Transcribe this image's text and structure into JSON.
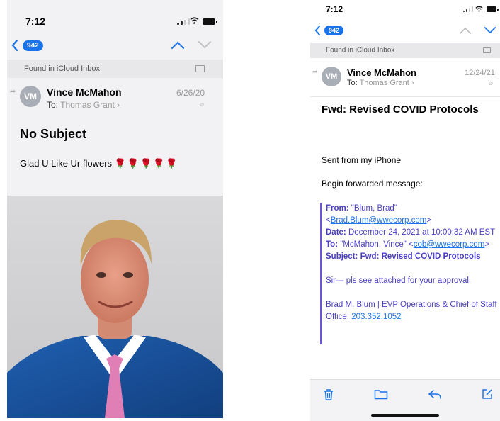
{
  "left": {
    "time": "7:12",
    "badge": "942",
    "found_label": "Found in iCloud Inbox",
    "avatar": "VM",
    "sender": "Vince McMahon",
    "to_prefix": "To:",
    "to_name": "Thomas Grant",
    "date": "6/26/20",
    "subject": "No Subject",
    "body": "Glad U Like Ur flowers",
    "roses": [
      "🌹",
      "🌹",
      "🌹",
      "🌹",
      "🌹"
    ]
  },
  "right": {
    "time": "7:12",
    "badge": "942",
    "found_label": "Found in iCloud Inbox",
    "avatar": "VM",
    "sender": "Vince McMahon",
    "to_prefix": "To:",
    "to_name": "Thomas Grant",
    "date": "12/24/21",
    "subject": "Fwd: Revised COVID Protocols",
    "sent_from": "Sent from my iPhone",
    "begin_forward": "Begin forwarded message:",
    "quote": {
      "from_label": "From:",
      "from_name": "\"Blum, Brad\"",
      "from_email": "Brad.Blum@wwecorp.com",
      "date_label": "Date:",
      "date_value": "December 24, 2021 at 10:00:32 AM EST",
      "to_label": "To:",
      "to_name": "\"McMahon, Vince\"",
      "to_email": "cob@wwecorp.com",
      "subject_label": "Subject:",
      "subject_value": "Fwd: Revised COVID Protocols",
      "message": "Sir— pls see attached for your approval.",
      "signature": "Brad M. Blum | EVP Operations & Chief of Staff",
      "office_label": "Office:",
      "office_phone": "203.352.1052"
    }
  },
  "colors": {
    "accent": "#1a73e8",
    "quote": "#4b3fc4",
    "avatar": "#a9aeb6"
  }
}
